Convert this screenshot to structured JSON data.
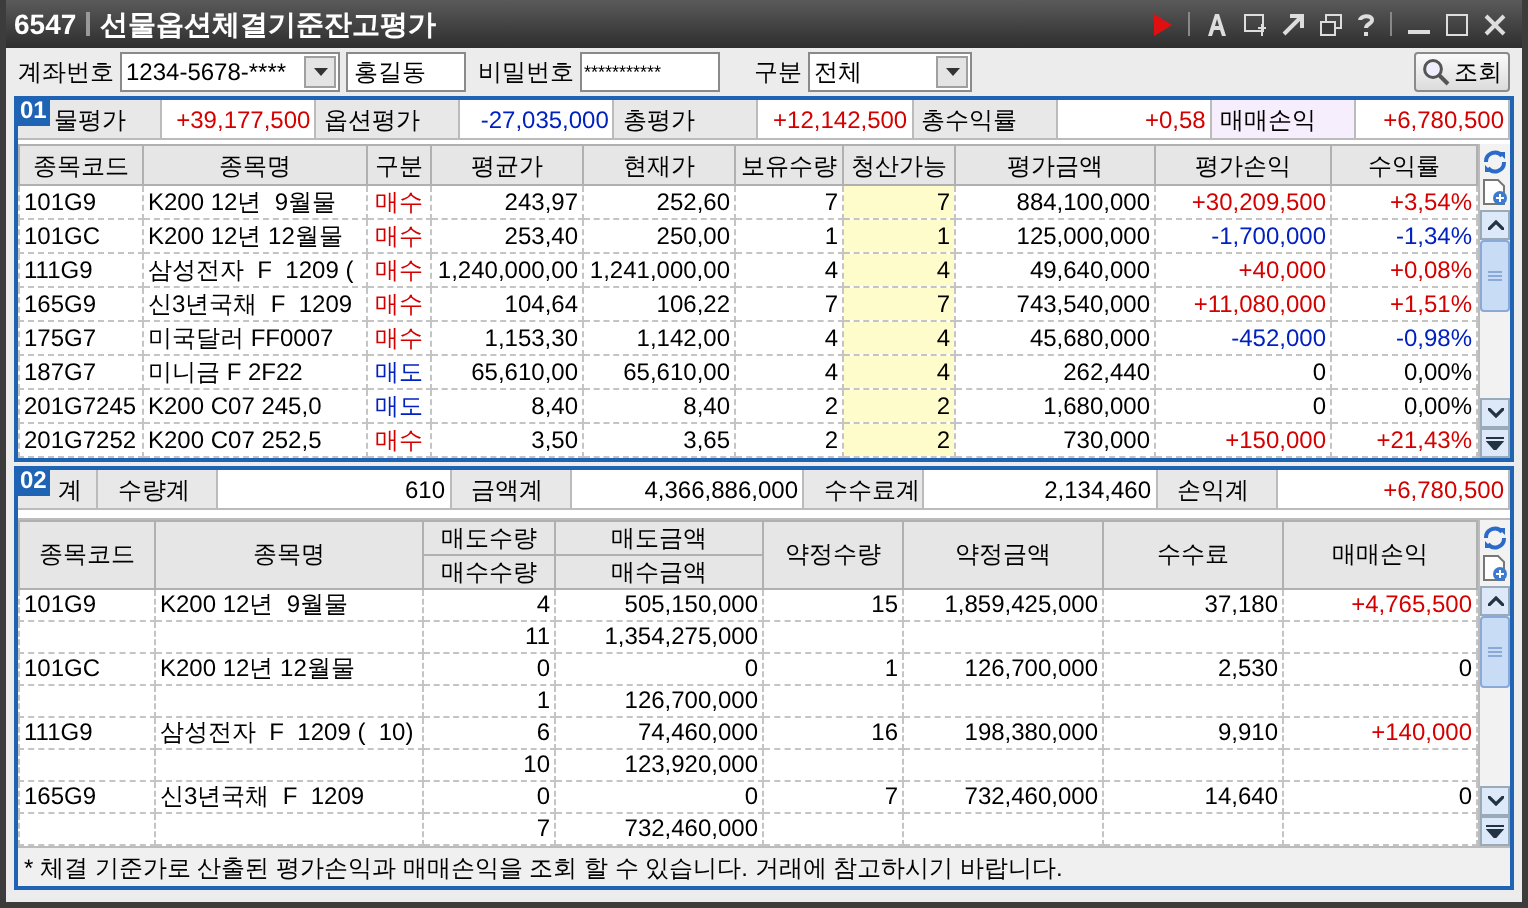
{
  "window": {
    "code": "6547",
    "title": "선물옵션체결기준잔고평가"
  },
  "query": {
    "account_label": "계좌번호",
    "account": "1234-5678-****",
    "holder": "홍길동",
    "password_label": "비밀번호",
    "password": "***********",
    "type_label": "구분",
    "type": "전체",
    "search_button": "조회"
  },
  "panel1": {
    "badge": "01",
    "summary": [
      {
        "label": "물평가",
        "value": "+39,177,500",
        "gain": true,
        "loss": false,
        "kind": "plain"
      },
      {
        "label": "옵션평가",
        "value": "-27,035,000",
        "gain": false,
        "loss": true,
        "kind": "plain"
      },
      {
        "label": "총평가",
        "value": "+12,142,500",
        "gain": true,
        "loss": false,
        "kind": "plain"
      },
      {
        "label": "총수익률",
        "value": "+0,58",
        "gain": true,
        "loss": false,
        "kind": "plain"
      },
      {
        "label": "매매손익",
        "value": "+6,780,500",
        "gain": true,
        "loss": false,
        "kind": "highlight"
      }
    ],
    "columns": [
      "종목코드",
      "종목명",
      "구분",
      "평균가",
      "현재가",
      "보유수량",
      "청산가능",
      "평가금액",
      "평가손익",
      "수익률"
    ],
    "rows": [
      {
        "code": "101G9",
        "name": "K200 12년  9월물",
        "side": "매수",
        "selling": false,
        "avg": "243,97",
        "cur": "252,60",
        "hold": "7",
        "liq": "7",
        "amount": "884,100,000",
        "pl": "+30,209,500",
        "rate": "+3,54%",
        "gain": true,
        "loss": false
      },
      {
        "code": "101GC",
        "name": "K200 12년 12월물",
        "side": "매수",
        "selling": false,
        "avg": "253,40",
        "cur": "250,00",
        "hold": "1",
        "liq": "1",
        "amount": "125,000,000",
        "pl": "-1,700,000",
        "rate": "-1,34%",
        "gain": false,
        "loss": true
      },
      {
        "code": "111G9",
        "name": "삼성전자  F  1209 (",
        "side": "매수",
        "selling": false,
        "avg": "1,240,000,00",
        "cur": "1,241,000,00",
        "hold": "4",
        "liq": "4",
        "amount": "49,640,000",
        "pl": "+40,000",
        "rate": "+0,08%",
        "gain": true,
        "loss": false
      },
      {
        "code": "165G9",
        "name": "신3년국채  F  1209",
        "side": "매수",
        "selling": false,
        "avg": "104,64",
        "cur": "106,22",
        "hold": "7",
        "liq": "7",
        "amount": "743,540,000",
        "pl": "+11,080,000",
        "rate": "+1,51%",
        "gain": true,
        "loss": false
      },
      {
        "code": "175G7",
        "name": "미국달러 FF0007",
        "side": "매수",
        "selling": false,
        "avg": "1,153,30",
        "cur": "1,142,00",
        "hold": "4",
        "liq": "4",
        "amount": "45,680,000",
        "pl": "-452,000",
        "rate": "-0,98%",
        "gain": false,
        "loss": true
      },
      {
        "code": "187G7",
        "name": "미니금 F 2F22",
        "side": "매도",
        "selling": true,
        "avg": "65,610,00",
        "cur": "65,610,00",
        "hold": "4",
        "liq": "4",
        "amount": "262,440",
        "pl": "0",
        "rate": "0,00%",
        "gain": false,
        "loss": false
      },
      {
        "code": "201G7245",
        "name": "K200 C07 245,0",
        "side": "매도",
        "selling": true,
        "avg": "8,40",
        "cur": "8,40",
        "hold": "2",
        "liq": "2",
        "amount": "1,680,000",
        "pl": "0",
        "rate": "0,00%",
        "gain": false,
        "loss": false
      },
      {
        "code": "201G7252",
        "name": "K200 C07 252,5",
        "side": "매수",
        "selling": false,
        "avg": "3,50",
        "cur": "3,65",
        "hold": "2",
        "liq": "2",
        "amount": "730,000",
        "pl": "+150,000",
        "rate": "+21,43%",
        "gain": true,
        "loss": false
      }
    ]
  },
  "panel2": {
    "badge": "02",
    "summary": [
      {
        "label": "계"
      },
      {
        "label": "수량계",
        "value": "610",
        "gain": false
      },
      {
        "label": "금액계",
        "value": "4,366,886,000",
        "gain": false
      },
      {
        "label": "수수료계",
        "value": "2,134,460",
        "gain": false
      },
      {
        "label": "손익계",
        "value": "+6,780,500",
        "gain": true
      }
    ],
    "columns": [
      {
        "kind": "single",
        "label": "종목코드"
      },
      {
        "kind": "single",
        "label": "종목명"
      },
      {
        "kind": "stacked",
        "labels": [
          "매도수량",
          "매수수량"
        ]
      },
      {
        "kind": "stacked",
        "labels": [
          "매도금액",
          "매수금액"
        ]
      },
      {
        "kind": "single",
        "label": "약정수량"
      },
      {
        "kind": "single",
        "label": "약정금액"
      },
      {
        "kind": "single",
        "label": "수수료"
      },
      {
        "kind": "single",
        "label": "매매손익"
      }
    ],
    "rows": [
      {
        "code": "101G9",
        "name": "K200 12년  9월물",
        "sell_qty": "4",
        "sell_amt": "505,150,000",
        "buy_qty": "11",
        "buy_amt": "1,354,275,000",
        "qty": "15",
        "amount": "1,859,425,000",
        "fee": "37,180",
        "pl": "+4,765,500",
        "gain": true
      },
      {
        "code": "101GC",
        "name": "K200 12년 12월물",
        "sell_qty": "0",
        "sell_amt": "0",
        "buy_qty": "1",
        "buy_amt": "126,700,000",
        "qty": "1",
        "amount": "126,700,000",
        "fee": "2,530",
        "pl": "0",
        "gain": false
      },
      {
        "code": "111G9",
        "name": "삼성전자  F  1209 (  10)",
        "sell_qty": "6",
        "sell_amt": "74,460,000",
        "buy_qty": "10",
        "buy_amt": "123,920,000",
        "qty": "16",
        "amount": "198,380,000",
        "fee": "9,910",
        "pl": "+140,000",
        "gain": true
      },
      {
        "code": "165G9",
        "name": "신3년국채  F  1209",
        "sell_qty": "0",
        "sell_amt": "0",
        "buy_qty": "7",
        "buy_amt": "732,460,000",
        "qty": "7",
        "amount": "732,460,000",
        "fee": "14,640",
        "pl": "0",
        "gain": false
      }
    ]
  },
  "note": "* 체결 기준가로 산출된 평가손익과 매매손익을 조회 할 수 있습니다. 거래에 참고하시기 바랍니다."
}
